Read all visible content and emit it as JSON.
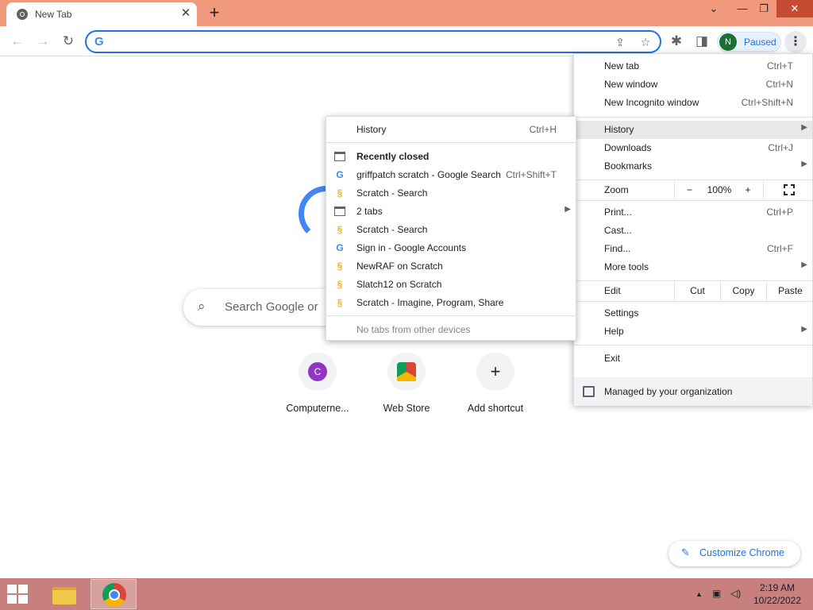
{
  "browser": {
    "tab_title": "New Tab",
    "tab_close": "✕",
    "new_tab": "+",
    "window_controls": {
      "dropdown": "⌄",
      "minimize": "—",
      "restore": "❐",
      "close": "✕"
    },
    "profile": {
      "initial": "N",
      "status": "Paused"
    },
    "accent_color": "#1a73e8"
  },
  "newtab": {
    "search_placeholder": "Search Google or",
    "shortcuts": [
      {
        "label": "Computerne...",
        "initial": "C"
      },
      {
        "label": "Web Store"
      },
      {
        "label": "Add shortcut",
        "glyph": "+"
      }
    ],
    "customize_label": "Customize Chrome"
  },
  "main_menu": {
    "new_tab": {
      "label": "New tab",
      "shortcut": "Ctrl+T"
    },
    "new_window": {
      "label": "New window",
      "shortcut": "Ctrl+N"
    },
    "incognito": {
      "label": "New Incognito window",
      "shortcut": "Ctrl+Shift+N"
    },
    "history": {
      "label": "History",
      "arrow": "▶"
    },
    "downloads": {
      "label": "Downloads",
      "shortcut": "Ctrl+J"
    },
    "bookmarks": {
      "label": "Bookmarks",
      "arrow": "▶"
    },
    "zoom": {
      "label": "Zoom",
      "minus": "−",
      "level": "100%",
      "plus": "+"
    },
    "print": {
      "label": "Print...",
      "shortcut": "Ctrl+P"
    },
    "cast": {
      "label": "Cast..."
    },
    "find": {
      "label": "Find...",
      "shortcut": "Ctrl+F"
    },
    "more_tools": {
      "label": "More tools",
      "arrow": "▶"
    },
    "edit": {
      "label": "Edit",
      "cut": "Cut",
      "copy": "Copy",
      "paste": "Paste"
    },
    "settings": {
      "label": "Settings"
    },
    "help": {
      "label": "Help",
      "arrow": "▶"
    },
    "exit": {
      "label": "Exit"
    },
    "managed": {
      "label": "Managed by your organization"
    }
  },
  "history_menu": {
    "history": {
      "label": "History",
      "shortcut": "Ctrl+H"
    },
    "recently_closed": "Recently closed",
    "items": [
      {
        "label": "griffpatch scratch - Google Search",
        "shortcut": "Ctrl+Shift+T",
        "icon": "google-icon"
      },
      {
        "label": "Scratch - Search",
        "icon": "scratch-icon"
      },
      {
        "label": "2 tabs",
        "icon": "window-icon",
        "arrow": "▶"
      },
      {
        "label": "Scratch - Search",
        "icon": "scratch-icon"
      },
      {
        "label": "Sign in - Google Accounts",
        "icon": "google-icon"
      },
      {
        "label": "NewRAF on Scratch",
        "icon": "scratch-icon"
      },
      {
        "label": "Slatch12 on Scratch",
        "icon": "scratch-icon"
      },
      {
        "label": "Scratch - Imagine, Program, Share",
        "icon": "scratch-icon"
      }
    ],
    "no_tabs": "No tabs from other devices"
  },
  "taskbar": {
    "time": "2:19 AM",
    "date": "10/22/2022",
    "tray_chevron": "▲"
  }
}
